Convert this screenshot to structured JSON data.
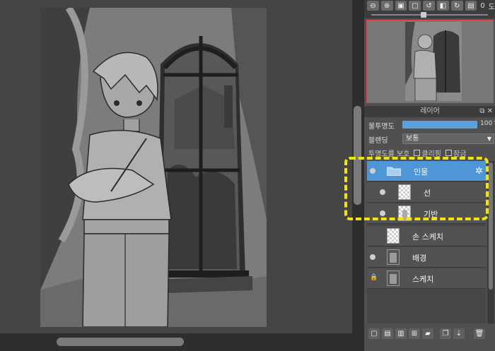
{
  "navigator": {
    "zoom_text": "0",
    "zoom_unit_char": "도"
  },
  "layer_panel": {
    "title": "레이어",
    "opacity_label": "불투명도",
    "opacity_value": "100 %",
    "opacity_fraction": 1.0,
    "blend_label": "블렌딩",
    "blend_value": "보통",
    "options": {
      "protect_alpha_label": "투명도를 보호",
      "clipping_label": "클리핑",
      "lock_label": "잠금"
    },
    "layers": [
      {
        "name": "인물",
        "type": "folder",
        "selected": true,
        "visible": true,
        "locked": false,
        "indent": 0
      },
      {
        "name": "선",
        "type": "raster",
        "selected": false,
        "visible": true,
        "locked": false,
        "indent": 1
      },
      {
        "name": "기반",
        "type": "raster",
        "selected": false,
        "visible": true,
        "locked": false,
        "indent": 1
      },
      {
        "name": "손 스케치",
        "type": "raster",
        "selected": false,
        "visible": false,
        "locked": false,
        "indent": 0
      },
      {
        "name": "배경",
        "type": "raster",
        "selected": false,
        "visible": true,
        "locked": false,
        "indent": 0
      },
      {
        "name": "스케치",
        "type": "raster",
        "selected": false,
        "visible": false,
        "locked": true,
        "indent": 0
      }
    ]
  },
  "colors": {
    "selection": "#4e96d6",
    "highlight": "#f5e400",
    "navigator_frame": "#dd4444"
  }
}
